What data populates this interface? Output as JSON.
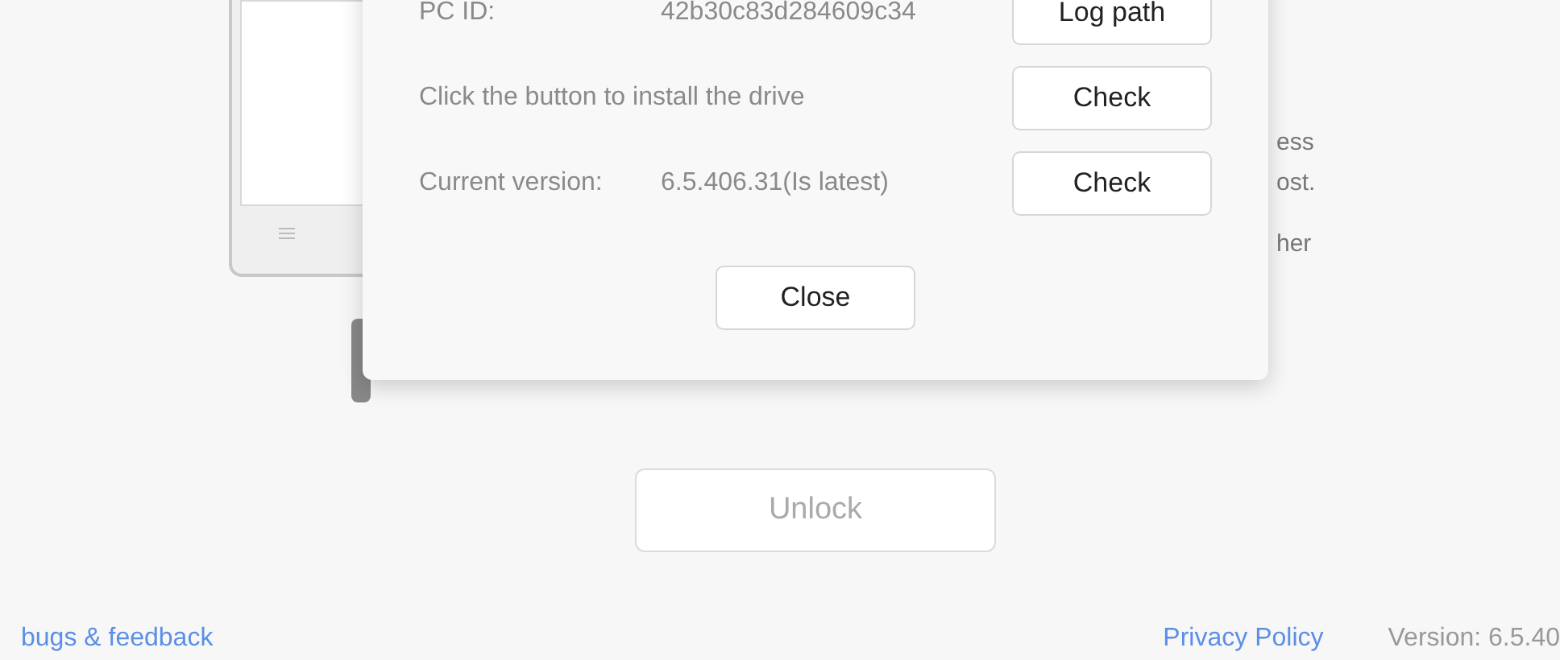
{
  "background_text": [
    {
      "text": "ess"
    },
    {
      "text": "ost."
    },
    {
      "text": "her"
    }
  ],
  "dialog": {
    "rows": [
      {
        "label": "PC ID:",
        "value": "42b30c83d284609c34",
        "button": "Log path"
      },
      {
        "label": "Click the button to install the drive",
        "button": "Check"
      },
      {
        "label": "Current version:",
        "value": "6.5.406.31(Is latest)",
        "button": "Check"
      }
    ],
    "close_button": "Close"
  },
  "unlock_button": {
    "label": "Unlock",
    "disabled": true
  },
  "footer": {
    "feedback_link": "bugs & feedback",
    "privacy_link": "Privacy Policy",
    "version": "Version: 6.5.40"
  }
}
